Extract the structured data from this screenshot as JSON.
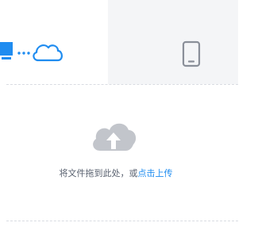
{
  "tabs": [
    {
      "name": "pc-upload",
      "icon": "computer-to-cloud-icon",
      "active": true,
      "color": "#1f8cf0"
    },
    {
      "name": "mobile-upload",
      "icon": "tablet-icon",
      "active": false,
      "color": "#8a8f99"
    }
  ],
  "upload": {
    "icon": "cloud-upload-icon",
    "prompt_text": "将文件拖到此处，或",
    "link_text": "点击上传",
    "link_color": "#1f8cf0"
  }
}
